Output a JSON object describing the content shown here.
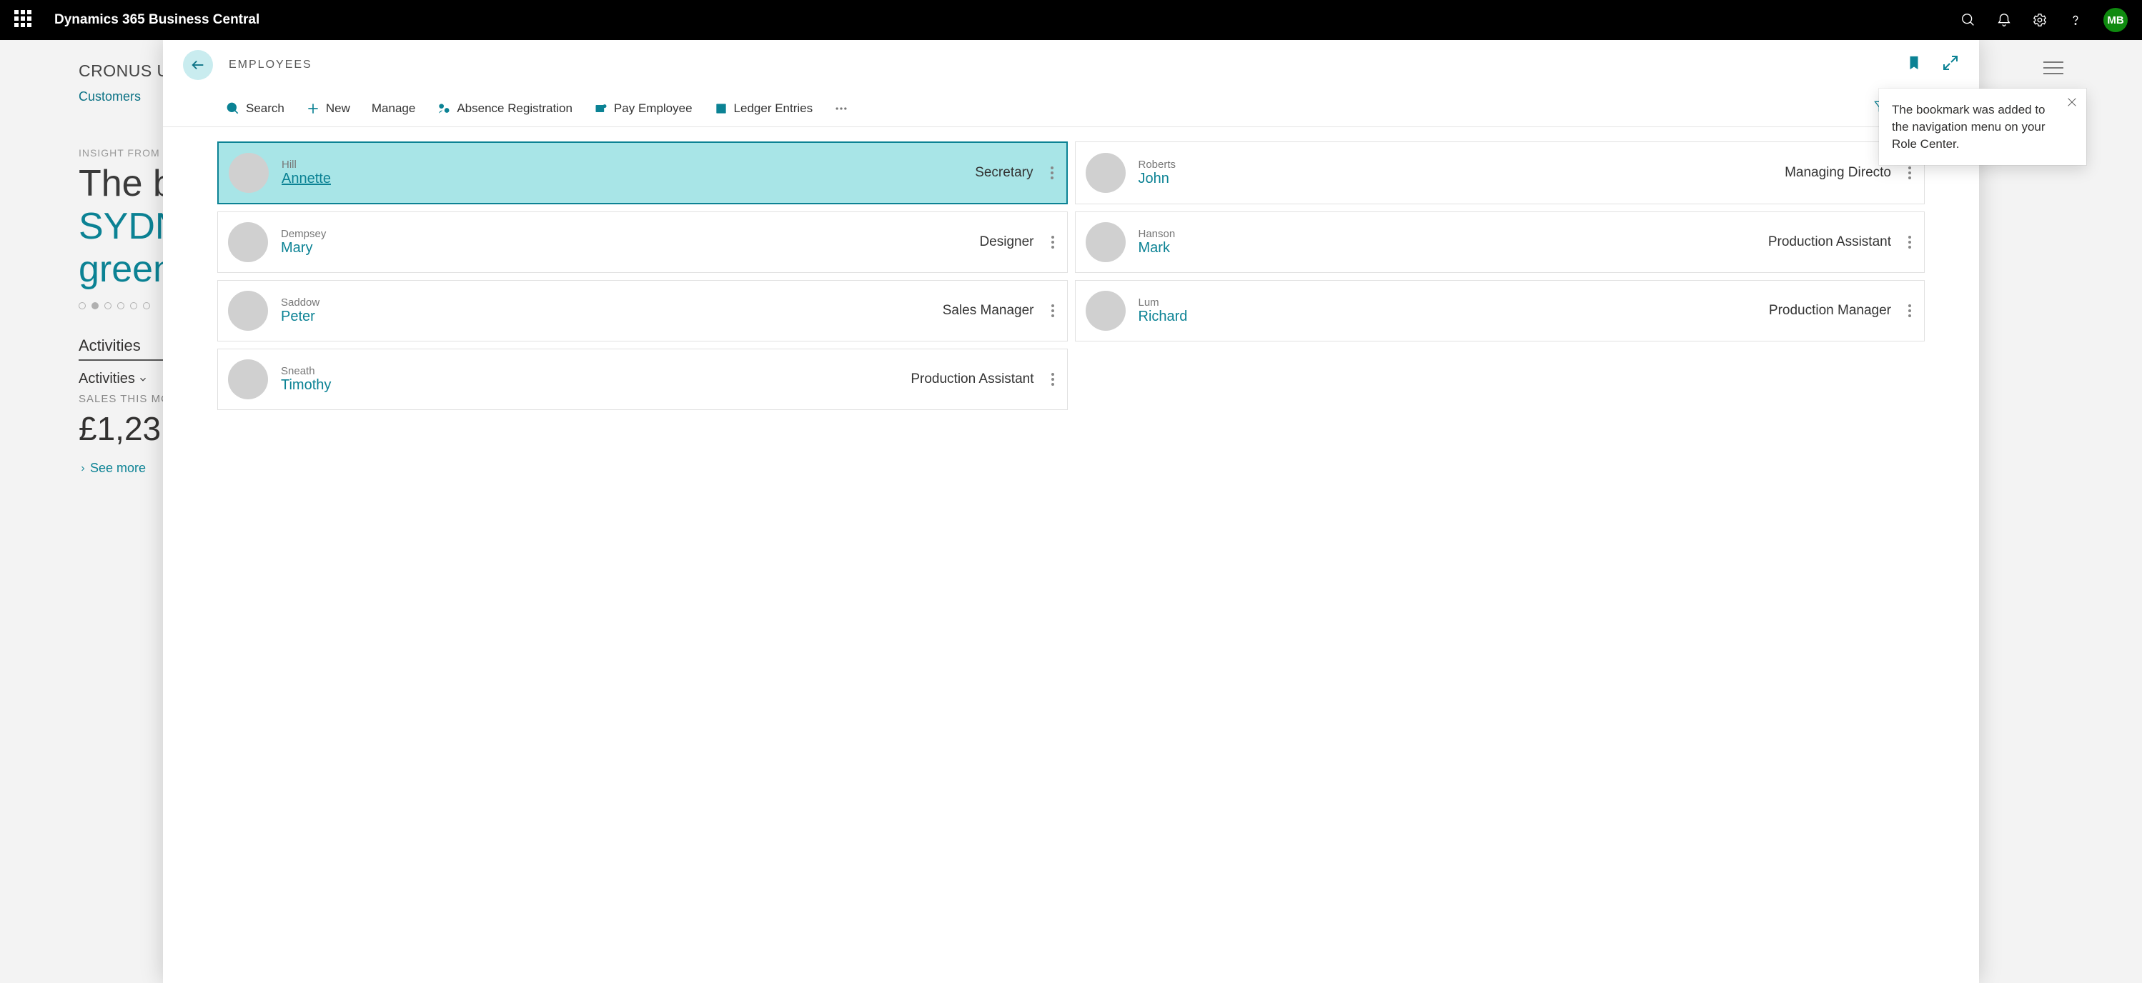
{
  "app": {
    "title": "Dynamics 365 Business Central",
    "user_initials": "MB"
  },
  "background": {
    "company": "CRONUS U",
    "nav_item": "Customers",
    "insight_label": "INSIGHT FROM L",
    "headline_line1": "The b",
    "headline_line2": "SYDN",
    "headline_line3": "green",
    "activities_title": "Activities",
    "activities_filter": "Activities",
    "sales_label": "SALES THIS MON",
    "big_number": "£1,23",
    "see_more": "See more"
  },
  "panel": {
    "title": "EMPLOYEES",
    "toolbar": {
      "search": "Search",
      "new": "New",
      "manage": "Manage",
      "absence": "Absence Registration",
      "pay": "Pay Employee",
      "ledger": "Ledger Entries"
    },
    "employees": [
      {
        "surname": "Hill",
        "firstname": "Annette",
        "role": "Secretary",
        "selected": true
      },
      {
        "surname": "Roberts",
        "firstname": "John",
        "role": "Managing Directo",
        "selected": false
      },
      {
        "surname": "Dempsey",
        "firstname": "Mary",
        "role": "Designer",
        "selected": false
      },
      {
        "surname": "Hanson",
        "firstname": "Mark",
        "role": "Production Assistant",
        "selected": false
      },
      {
        "surname": "Saddow",
        "firstname": "Peter",
        "role": "Sales Manager",
        "selected": false
      },
      {
        "surname": "Lum",
        "firstname": "Richard",
        "role": "Production Manager",
        "selected": false
      },
      {
        "surname": "Sneath",
        "firstname": "Timothy",
        "role": "Production Assistant",
        "selected": false
      }
    ]
  },
  "popup": {
    "message": "The bookmark was added to the navigation menu on your Role Center."
  }
}
